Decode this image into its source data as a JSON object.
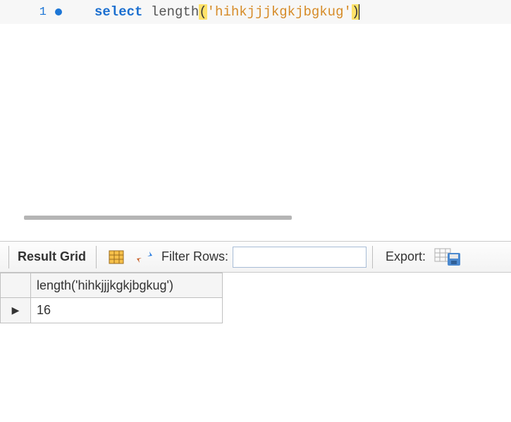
{
  "editor": {
    "line_number": "1",
    "keyword": "select",
    "space1": " ",
    "function_name": "length",
    "open_paren": "(",
    "string_literal": "'hihkjjjkgkjbgkug'",
    "close_paren": ")"
  },
  "toolbar": {
    "result_grid_label": "Result Grid",
    "filter_label": "Filter Rows:",
    "filter_value": "",
    "filter_placeholder": "",
    "export_label": "Export:"
  },
  "results": {
    "columns": [
      "length('hihkjjjkgkjbgkug')"
    ],
    "rows": [
      {
        "cells": [
          "16"
        ],
        "current": true
      }
    ]
  }
}
